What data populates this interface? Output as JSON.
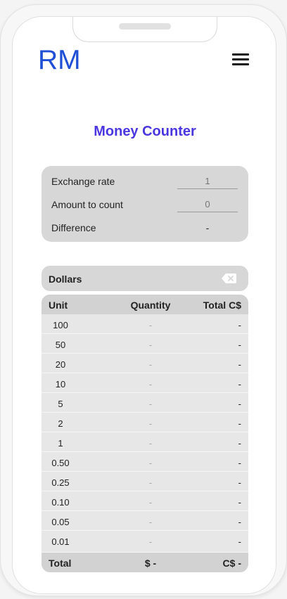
{
  "app": {
    "logo": "RM",
    "title": "Money Counter"
  },
  "colors": {
    "logo": "#1f4fd4",
    "title": "#4a36e0",
    "panel": "#d7d7d7",
    "table": "#e7e7e7"
  },
  "icons": {
    "menu": "hamburger-menu-icon",
    "clear": "backspace-icon"
  },
  "summary": {
    "exchange_rate": {
      "label": "Exchange rate",
      "placeholder": "1"
    },
    "amount_to_count": {
      "label": "Amount to count",
      "placeholder": "0"
    },
    "difference": {
      "label": "Difference",
      "value": "-"
    }
  },
  "currency": {
    "label": "Dollars"
  },
  "table": {
    "headers": {
      "unit": "Unit",
      "quantity": "Quantity",
      "total": "Total C$"
    },
    "rows": [
      {
        "unit": "100",
        "quantity": "-",
        "total": "-"
      },
      {
        "unit": "50",
        "quantity": "-",
        "total": "-"
      },
      {
        "unit": "20",
        "quantity": "-",
        "total": "-"
      },
      {
        "unit": "10",
        "quantity": "-",
        "total": "-"
      },
      {
        "unit": "5",
        "quantity": "-",
        "total": "-"
      },
      {
        "unit": "2",
        "quantity": "-",
        "total": "-"
      },
      {
        "unit": "1",
        "quantity": "-",
        "total": "-"
      },
      {
        "unit": "0.50",
        "quantity": "-",
        "total": "-"
      },
      {
        "unit": "0.25",
        "quantity": "-",
        "total": "-"
      },
      {
        "unit": "0.10",
        "quantity": "-",
        "total": "-"
      },
      {
        "unit": "0.05",
        "quantity": "-",
        "total": "-"
      },
      {
        "unit": "0.01",
        "quantity": "-",
        "total": "-"
      }
    ],
    "footer": {
      "label": "Total",
      "quantity": "$ -",
      "total": "C$ -"
    }
  }
}
